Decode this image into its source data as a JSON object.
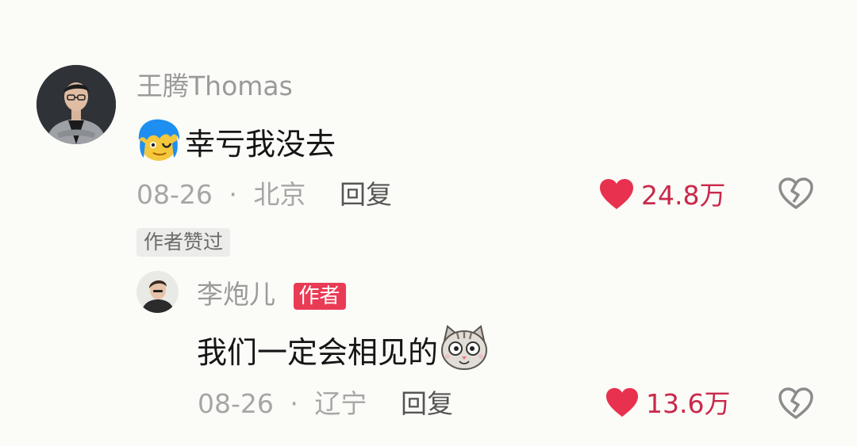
{
  "comment": {
    "username": "王腾Thomas",
    "emoji_before": "blue-hair-face-emoji",
    "text": "幸亏我没去",
    "date": "08-26",
    "separator": "·",
    "location": "北京",
    "reply_label": "回复",
    "like_count": "24.8万",
    "author_liked_label": "作者赞过",
    "colors": {
      "like_heart": "#e8314f",
      "like_count": "#c9294a"
    }
  },
  "reply": {
    "username": "李炮儿",
    "author_badge": "作者",
    "text": "我们一定会相见的",
    "emoji_after": "cat-face-emoji",
    "date": "08-26",
    "separator": "·",
    "location": "辽宁",
    "reply_label": "回复",
    "like_count": "13.6万",
    "colors": {
      "author_badge_bg": "#ea3b55"
    }
  }
}
